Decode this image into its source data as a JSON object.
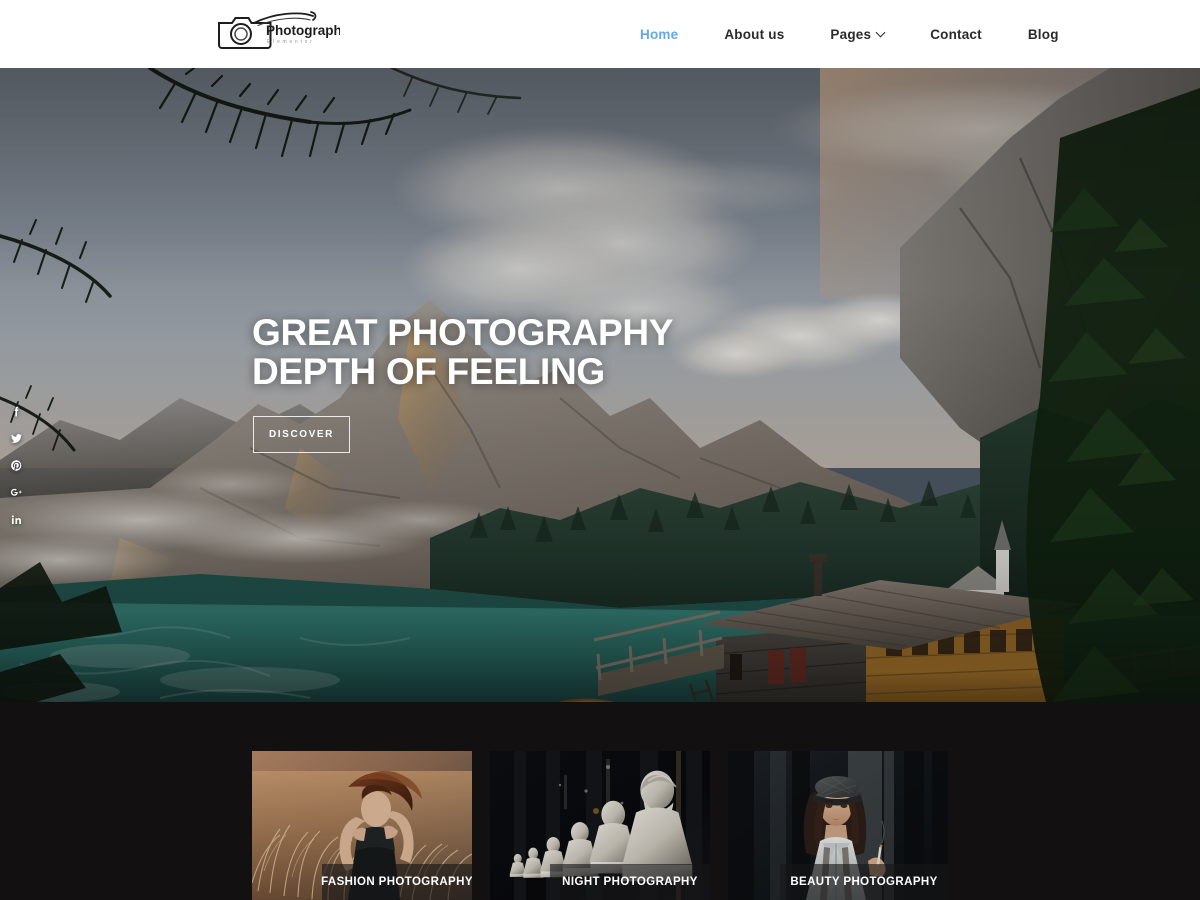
{
  "header": {
    "logo": {
      "name": "photography-elementor-logo",
      "primary_text": "Photography",
      "secondary_text": "Elementor",
      "icon": "camera-icon"
    },
    "nav": [
      {
        "label": "Home",
        "active": true,
        "has_dropdown": false,
        "name": "nav-home"
      },
      {
        "label": "About us",
        "active": false,
        "has_dropdown": false,
        "name": "nav-about-us"
      },
      {
        "label": "Pages",
        "active": false,
        "has_dropdown": true,
        "name": "nav-pages"
      },
      {
        "label": "Contact",
        "active": false,
        "has_dropdown": false,
        "name": "nav-contact"
      },
      {
        "label": "Blog",
        "active": false,
        "has_dropdown": false,
        "name": "nav-blog"
      }
    ],
    "background_color": "#ffffff",
    "active_link_color": "#62a9e8",
    "link_color": "#2b2b2b"
  },
  "hero": {
    "title_line1": "GREAT PHOTOGRAPHY",
    "title_line2": "DEPTH OF FEELING",
    "title": "GREAT PHOTOGRAPHY\nDEPTH OF FEELING",
    "cta_label": "DISCOVER",
    "title_color": "#ffffff",
    "image_description": "Mountain lake with wooden boathouse on pilings, pine forest and clouded peaks"
  },
  "social": {
    "items": [
      {
        "label": "Facebook",
        "icon": "facebook-icon",
        "name": "social-facebook"
      },
      {
        "label": "Twitter",
        "icon": "twitter-icon",
        "name": "social-twitter"
      },
      {
        "label": "Pinterest",
        "icon": "pinterest-icon",
        "name": "social-pinterest"
      },
      {
        "label": "Google Plus",
        "icon": "google-plus-icon",
        "name": "social-google-plus"
      },
      {
        "label": "LinkedIn",
        "icon": "linkedin-icon",
        "name": "social-linkedin"
      }
    ],
    "icon_color": "#ffffff"
  },
  "gallery": {
    "background_color": "#121010",
    "cards": [
      {
        "caption": "FASHION PHOTOGRAPHY",
        "name": "gallery-card-fashion",
        "image_description": "Woman with windblown hair in golden pampas grass field at sunset"
      },
      {
        "caption": "NIGHT PHOTOGRAPHY",
        "name": "gallery-card-night",
        "image_description": "Row of white marble classical busts lit in a dark gallery"
      },
      {
        "caption": "BEAUTY PHOTOGRAPHY",
        "name": "gallery-card-beauty",
        "image_description": "Portrait of a woman in flat cap and white shirt in dim interior"
      }
    ]
  }
}
